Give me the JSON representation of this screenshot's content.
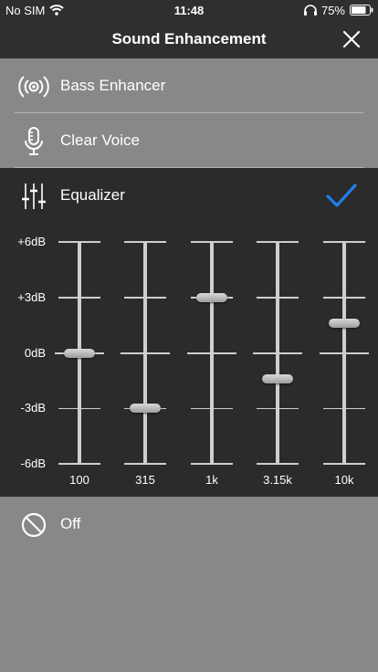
{
  "status": {
    "carrier": "No SIM",
    "time": "11:48",
    "battery": "75%"
  },
  "header": {
    "title": "Sound Enhancement"
  },
  "options": [
    {
      "label": "Bass Enhancer",
      "icon": "bass-enhancer-icon"
    },
    {
      "label": "Clear Voice",
      "icon": "microphone-icon"
    },
    {
      "label": "Equalizer",
      "icon": "equalizer-sliders-icon",
      "selected": true
    },
    {
      "label": "Off",
      "icon": "off-circle-icon"
    }
  ],
  "equalizer": {
    "db_labels": [
      "+6dB",
      "+3dB",
      "0dB",
      "-3dB",
      "-6dB"
    ],
    "bands": [
      {
        "freq": "100",
        "gain_db": 0
      },
      {
        "freq": "315",
        "gain_db": -3
      },
      {
        "freq": "1k",
        "gain_db": 3
      },
      {
        "freq": "3.15k",
        "gain_db": -1.4
      },
      {
        "freq": "10k",
        "gain_db": 1.6
      }
    ]
  },
  "colors": {
    "accent": "#1e7ff0",
    "panel": "#2b2b2b",
    "background": "#888888"
  }
}
